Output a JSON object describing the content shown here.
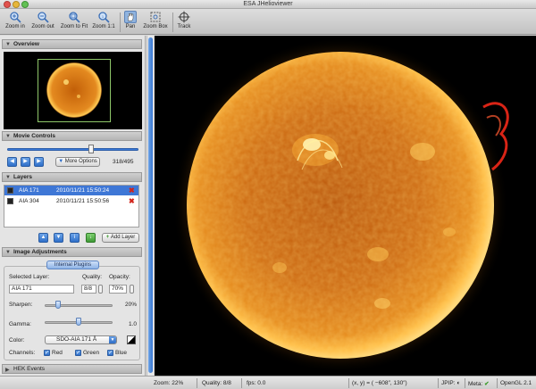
{
  "window": {
    "title": "ESA JHelioviewer"
  },
  "toolbar": {
    "items": [
      {
        "label": "Zoom in",
        "icon": "zoom-in-icon"
      },
      {
        "label": "Zoom out",
        "icon": "zoom-out-icon"
      },
      {
        "label": "Zoom to Fit",
        "icon": "zoom-fit-icon"
      },
      {
        "label": "Zoom 1:1",
        "icon": "zoom-1to1-icon"
      },
      {
        "label": "Pan",
        "icon": "pan-icon",
        "active": true
      },
      {
        "label": "Zoom Box",
        "icon": "zoom-box-icon"
      },
      {
        "label": "Track",
        "icon": "track-icon"
      }
    ]
  },
  "sections": {
    "overview": "Overview",
    "movie_controls": "Movie Controls",
    "layers": "Layers",
    "image_adjustments": "Image Adjustments",
    "hek_events": "HEK Events"
  },
  "movie": {
    "more_options": "More Options",
    "frame_counter": "318/495",
    "position_fraction": 0.64
  },
  "layers": {
    "rows": [
      {
        "name": "AIA 171",
        "date": "2010/11/21 15:50:24",
        "selected": true
      },
      {
        "name": "AIA 304",
        "date": "2010/11/21 15:50:56",
        "selected": false
      }
    ],
    "add_layer": "Add Layer"
  },
  "adjust": {
    "tab": "Internal Plugins",
    "selected_layer_label": "Selected Layer:",
    "selected_layer_value": "AIA 171",
    "quality_label": "Quality:",
    "quality_value": "8/8",
    "opacity_label": "Opacity:",
    "opacity_value": "70%",
    "sharpen_label": "Sharpen:",
    "sharpen_value": "20%",
    "sharpen_fraction": 0.2,
    "gamma_label": "Gamma:",
    "gamma_value": "1.0",
    "gamma_fraction": 0.5,
    "color_label": "Color:",
    "color_value": "SDO-AIA 171 Å",
    "channels_label": "Channels:",
    "channels": [
      "Red",
      "Green",
      "Blue"
    ]
  },
  "status": {
    "zoom": "Zoom: 22%",
    "quality": "Quality: 8/8",
    "fps": "fps: 0.0",
    "coords": "(x, y) = ( −608″,    130″)",
    "jpip": "JPIP:",
    "meta": "Meta:",
    "opengl": "OpenGL 2.1"
  },
  "colors": {
    "accent": "#3e77d6",
    "sun_core": "#e07a12",
    "sun_edge": "#ffc04a"
  }
}
